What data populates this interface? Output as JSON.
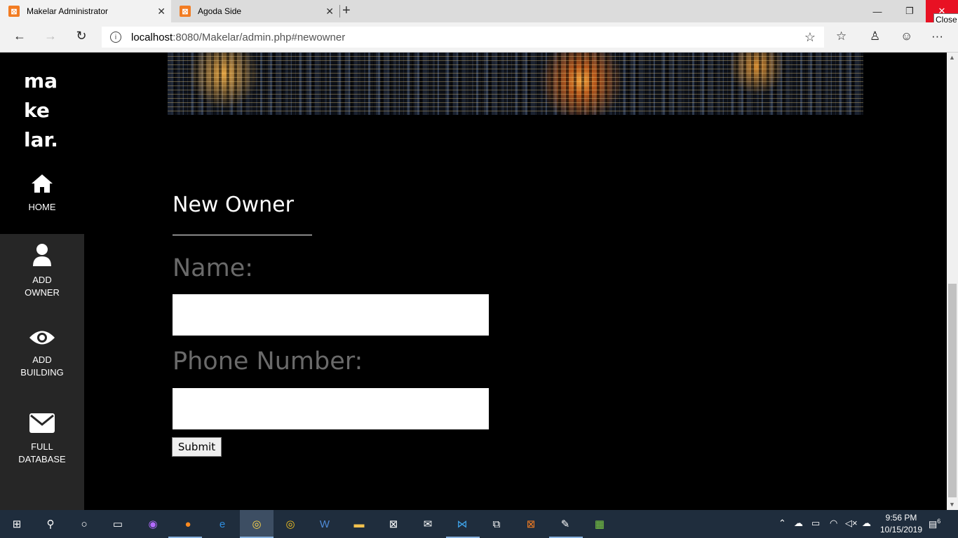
{
  "browser": {
    "tabs": [
      {
        "title": "Makelar Administrator",
        "active": true
      },
      {
        "title": "Agoda Side",
        "active": false
      }
    ],
    "tooltip": "Close",
    "url_host": "localhost",
    "url_rest": ":8080/Makelar/admin.php#newowner"
  },
  "sidebar": {
    "logo_lines": [
      "ma",
      "ke",
      "lar."
    ],
    "items": [
      {
        "line1": "HOME",
        "line2": "",
        "icon": "home-icon"
      },
      {
        "line1": "ADD",
        "line2": "OWNER",
        "icon": "user-icon"
      },
      {
        "line1": "ADD",
        "line2": "BUILDING",
        "icon": "eye-icon"
      },
      {
        "line1": "FULL",
        "line2": "DATABASE",
        "icon": "envelope-icon"
      }
    ]
  },
  "form": {
    "title": "New Owner",
    "name_label": "Name:",
    "name_value": "",
    "phone_label": "Phone Number:",
    "phone_value": "",
    "submit_label": "Submit"
  },
  "taskbar": {
    "time": "9:56 PM",
    "date": "10/15/2019",
    "notifications": "6"
  },
  "colors": {
    "tab_favicon": "#f27c22",
    "window_close": "#e81123",
    "sidebar_lower": "#262626",
    "label_gray": "#6a6a6a",
    "taskbar": "#1f2d3d"
  }
}
